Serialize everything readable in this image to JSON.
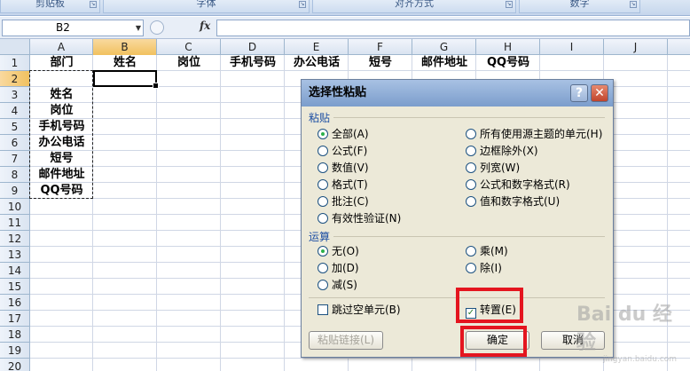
{
  "ribbon": {
    "groups": [
      {
        "label": "剪贴板"
      },
      {
        "label": "字体"
      },
      {
        "label": "对齐方式"
      },
      {
        "label": "数字"
      }
    ]
  },
  "formula_bar": {
    "name_box": "B2",
    "fx_label": "fx",
    "formula": ""
  },
  "sheet": {
    "columns": [
      "A",
      "B",
      "C",
      "D",
      "E",
      "F",
      "G",
      "H",
      "I",
      "J"
    ],
    "rows": [
      "1",
      "2",
      "3",
      "4",
      "5",
      "6",
      "7",
      "8",
      "9",
      "10",
      "11",
      "12",
      "13",
      "14",
      "15",
      "16",
      "17",
      "18",
      "19",
      "20"
    ],
    "header_row": [
      "部门",
      "姓名",
      "岗位",
      "手机号码",
      "办公电话",
      "短号",
      "邮件地址",
      "QQ号码"
    ],
    "column_a": [
      "姓名",
      "岗位",
      "手机号码",
      "办公电话",
      "短号",
      "邮件地址",
      "QQ号码"
    ],
    "selected_cell": "B2"
  },
  "dialog": {
    "title": "选择性粘贴",
    "help_label": "?",
    "close_label": "✕",
    "paste_section": "粘贴",
    "paste_options_left": [
      {
        "label": "全部(A)",
        "selected": true
      },
      {
        "label": "公式(F)",
        "selected": false
      },
      {
        "label": "数值(V)",
        "selected": false
      },
      {
        "label": "格式(T)",
        "selected": false
      },
      {
        "label": "批注(C)",
        "selected": false
      },
      {
        "label": "有效性验证(N)",
        "selected": false
      }
    ],
    "paste_options_right": [
      {
        "label": "所有使用源主题的单元(H)",
        "selected": false
      },
      {
        "label": "边框除外(X)",
        "selected": false
      },
      {
        "label": "列宽(W)",
        "selected": false
      },
      {
        "label": "公式和数字格式(R)",
        "selected": false
      },
      {
        "label": "值和数字格式(U)",
        "selected": false
      }
    ],
    "operation_section": "运算",
    "operation_left": [
      {
        "label": "无(O)",
        "selected": true
      },
      {
        "label": "加(D)",
        "selected": false
      },
      {
        "label": "减(S)",
        "selected": false
      }
    ],
    "operation_right": [
      {
        "label": "乘(M)",
        "selected": false
      },
      {
        "label": "除(I)",
        "selected": false
      }
    ],
    "skip_blanks": {
      "label": "跳过空单元(B)",
      "checked": false
    },
    "transpose": {
      "label": "转置(E)",
      "checked": true
    },
    "paste_link_label": "粘贴链接(L)",
    "ok_label": "确定",
    "cancel_label": "取消"
  },
  "watermark": {
    "text": "Bai du 经验",
    "sub": "jingyan.baidu.com"
  },
  "colors": {
    "highlight": "#e4151f",
    "accent": "#1c4ea3"
  }
}
